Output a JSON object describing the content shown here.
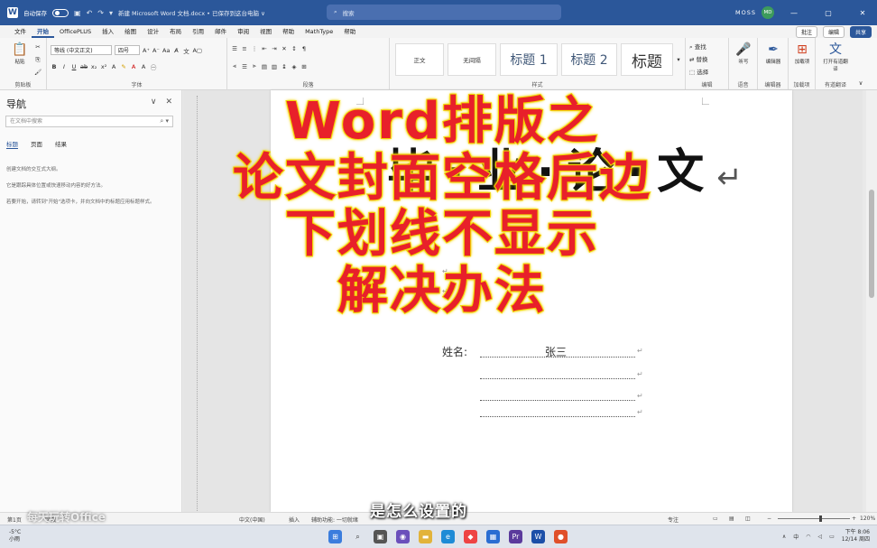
{
  "titlebar": {
    "autosave_label": "自动保存",
    "toggle_state": "关",
    "doc_title": "新建 Microsoft Word 文档.docx • 已保存到这台电脑 ∨",
    "search_placeholder": "搜索",
    "user_name": "MOSS",
    "user_initials": "MD"
  },
  "menu": {
    "tabs": [
      "文件",
      "开始",
      "OfficePLUS",
      "插入",
      "绘图",
      "设计",
      "布局",
      "引用",
      "邮件",
      "审阅",
      "视图",
      "帮助",
      "MathType",
      "帮助"
    ],
    "active_index": 1,
    "comment_label": "批注",
    "edit_label": "编辑",
    "share_label": "共享"
  },
  "ribbon": {
    "clipboard": {
      "paste_label": "粘贴",
      "group_label": "剪贴板"
    },
    "font": {
      "font_name": "等线 (中文正文)",
      "font_size": "四号",
      "group_label": "字体"
    },
    "paragraph": {
      "group_label": "段落"
    },
    "styles": {
      "items": [
        "正文",
        "无间隔",
        "标题 1",
        "标题 2",
        "标题"
      ],
      "group_label": "样式"
    },
    "editing": {
      "find": "查找",
      "replace": "替换",
      "select": "选择",
      "group_label": "编辑"
    },
    "voice": {
      "label": "听写",
      "group_label": "语音"
    },
    "editor": {
      "label": "编辑器",
      "group_label": "编辑器"
    },
    "addins": {
      "label": "加载项",
      "group_label": "加载项"
    },
    "translate": {
      "label": "打开有道翻译",
      "group_label": "有道翻译"
    }
  },
  "nav": {
    "title": "导航",
    "search_placeholder": "在文档中搜索",
    "tabs": [
      "标题",
      "页面",
      "结果"
    ],
    "hint_1": "创建文档的交互式大纲。",
    "hint_2": "它是跟踪具体位置或快速移动内容的好方法。",
    "hint_3": "若要开始，请转到\"开始\"选项卡，并向文档中的标题应用标题样式。"
  },
  "document": {
    "heading": "毕·业·论·文",
    "heading_return": "↵",
    "field_label": "姓名:",
    "field_value": "张三",
    "para_mark": "↵"
  },
  "overlay": {
    "lines": [
      "Word排版之",
      "论文封面空格后边",
      "下划线不显示",
      "解决办法"
    ],
    "color": "#e8202a",
    "outline_color": "#f3d400"
  },
  "subtitle": "是怎么设置的",
  "watermark": "每天玩转Office",
  "statusbar": {
    "page": "第1页",
    "words": "字数",
    "language": "中文(中国)",
    "input": "插入",
    "access": "辅助功能: 一切就绪",
    "focus": "专注",
    "zoom": "120%"
  },
  "taskbar": {
    "temp": "-5°C",
    "weather": "小雨",
    "time": "下午 8:06",
    "date": "12/14 周四"
  },
  "colors": {
    "word_blue": "#2b579a",
    "ribbon_bg": "#f7f7f7"
  }
}
